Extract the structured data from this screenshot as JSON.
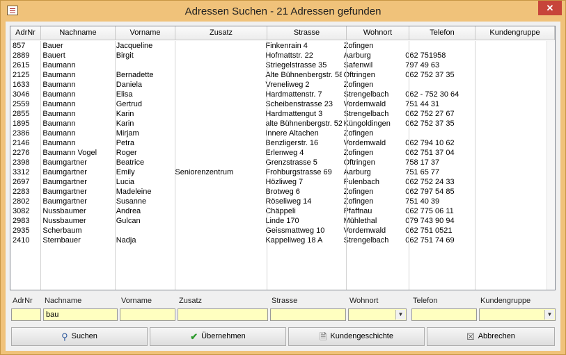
{
  "window": {
    "title": "Adressen Suchen - 21 Adressen gefunden",
    "close_label": "✕"
  },
  "columns": [
    "AdrNr",
    "Nachname",
    "Vorname",
    "Zusatz",
    "Strasse",
    "Wohnort",
    "Telefon",
    "Kundengruppe"
  ],
  "rows": [
    [
      "857",
      "Bauer",
      "Jacqueline",
      "",
      "Finkenrain 4",
      "Zofingen",
      "",
      ""
    ],
    [
      "2889",
      "Bauert",
      "Birgit",
      "",
      "Hofmattstr. 22",
      "Aarburg",
      "062 751958",
      ""
    ],
    [
      "2615",
      "Baumann",
      "",
      "",
      "Striegelstrasse 35",
      "Safenwil",
      "797 49 63",
      ""
    ],
    [
      "2125",
      "Baumann",
      "Bernadette",
      "",
      "Alte Bühnenbergstr. 58",
      "Oftringen",
      "062  752 37 35",
      ""
    ],
    [
      "1633",
      "Baumann",
      "Daniela",
      "",
      "Vreneliweg 2",
      "Zofingen",
      "",
      ""
    ],
    [
      "3046",
      "Baumann",
      "Elisa",
      "",
      "Hardmattenstr. 7",
      "Strengelbach",
      "062 - 752 30 64",
      ""
    ],
    [
      "2559",
      "Baumann",
      "Gertrud",
      "",
      "Scheibenstrasse 23",
      "Vordemwald",
      "751 44 31",
      ""
    ],
    [
      "2855",
      "Baumann",
      "Karin",
      "",
      "Hardmattengut 3",
      "Strengelbach",
      "062 752 27 67",
      ""
    ],
    [
      "1895",
      "Baumann",
      "Karin",
      "",
      "alte Bühnenbergstr. 52",
      "Küngoldingen",
      "062  752 37 35",
      ""
    ],
    [
      "2386",
      "Baumann",
      "Mirjam",
      "",
      "Innere Altachen",
      "Zofingen",
      "",
      ""
    ],
    [
      "2146",
      "Baumann",
      "Petra",
      "",
      "Benzligerstr. 16",
      "Vordemwald",
      "062 794 10 62",
      ""
    ],
    [
      "2276",
      "Baumann Vogel",
      "Roger",
      "",
      "Erlenweg 4",
      "Zofingen",
      "062 751 37 04",
      ""
    ],
    [
      "2398",
      "Baumgartner",
      "Beatrice",
      "",
      "Grenzstrasse 5",
      "Oftringen",
      "758 17 37",
      ""
    ],
    [
      "3312",
      "Baumgartner",
      "Emily",
      "Seniorenzentrum",
      "Frohburgstrasse 69",
      "Aarburg",
      "751 65 77",
      ""
    ],
    [
      "2697",
      "Baumgartner",
      "Lucia",
      "",
      "Hözliweg 7",
      "Fulenbach",
      "062 752 24 33",
      ""
    ],
    [
      "2283",
      "Baumgartner",
      "Madeleine",
      "",
      "Brotweg 6",
      "Zofingen",
      "062 797 54 85",
      ""
    ],
    [
      "2802",
      "Baumgartner",
      "Susanne",
      "",
      "Röseliweg 14",
      "Zofingen",
      "751 40 39",
      ""
    ],
    [
      "3082",
      "Nussbaumer",
      "Andrea",
      "",
      "Chäppeli",
      "Pfaffnau",
      "062  775 06 11",
      ""
    ],
    [
      "2983",
      "Nussbaumer",
      "Gulcan",
      "",
      "Linde 170",
      "Mühlethal",
      "079 743 90 94",
      ""
    ],
    [
      "2935",
      "Scherbaum",
      "",
      "",
      "Geissmattweg 10",
      "Vordemwald",
      "062 751 0521",
      ""
    ],
    [
      "2410",
      "Sternbauer",
      "Nadja",
      "",
      "Kappeliweg 18 A",
      "Strengelbach",
      "062  751 74 69",
      ""
    ]
  ],
  "filter_labels": [
    "AdrNr",
    "Nachname",
    "Vorname",
    "Zusatz",
    "Strasse",
    "Wohnort",
    "Telefon",
    "Kundengruppe"
  ],
  "filter_values": [
    "",
    "bau",
    "",
    "",
    "",
    "",
    "",
    ""
  ],
  "buttons": {
    "search": "Suchen",
    "apply": "Übernehmen",
    "history": "Kundengeschichte",
    "cancel": "Abbrechen"
  },
  "colors": {
    "frame": "#f0c27a",
    "filter_bg": "#ffffc0",
    "close": "#c7453a"
  }
}
